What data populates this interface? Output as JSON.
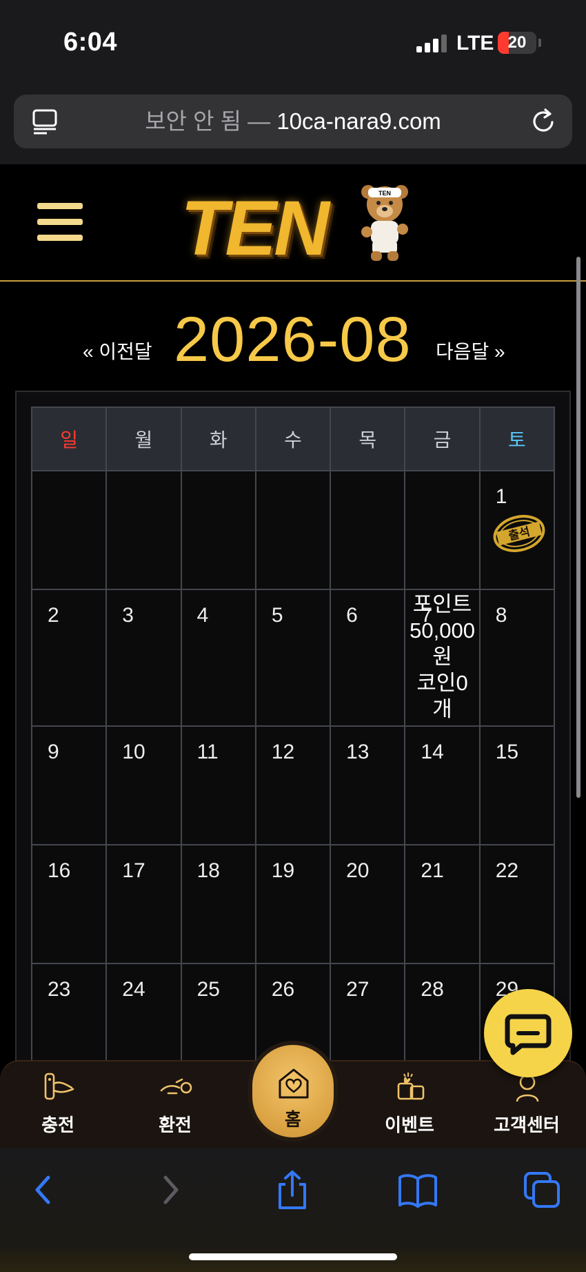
{
  "status_bar": {
    "time": "6:04",
    "network": "LTE",
    "battery": "20"
  },
  "url_bar": {
    "insecure_label": "보안 안 됨 —",
    "domain": "10ca-nara9.com"
  },
  "header": {
    "logo_text": "TEN",
    "logo_bear_badge": "TEN",
    "logo_alt": "TEN"
  },
  "calendar": {
    "prev_label": "« 이전달",
    "title": "2026-08",
    "next_label": "다음달 »",
    "weekdays": [
      "일",
      "월",
      "화",
      "수",
      "목",
      "금",
      "토"
    ],
    "stamp_text": "출석",
    "weeks": [
      [
        "",
        "",
        "",
        "",
        "",
        "",
        "1"
      ],
      [
        "2",
        "3",
        "4",
        "5",
        "6",
        "7",
        "8"
      ],
      [
        "9",
        "10",
        "11",
        "12",
        "13",
        "14",
        "15"
      ],
      [
        "16",
        "17",
        "18",
        "19",
        "20",
        "21",
        "22"
      ],
      [
        "23",
        "24",
        "25",
        "26",
        "27",
        "28",
        "29"
      ]
    ],
    "reward": {
      "line1": "포인트",
      "line2": "50,000",
      "line3": "원",
      "line4": "코인0",
      "line5": "개"
    }
  },
  "bottom_nav": {
    "charge": "충전",
    "withdraw": "환전",
    "home": "홈",
    "event": "이벤트",
    "support": "고객센터"
  },
  "icons": {
    "accent": "#f7c948",
    "sunday": "#ff3b30",
    "saturday": "#5ac8fa",
    "safari_blue": "#3478f6"
  }
}
